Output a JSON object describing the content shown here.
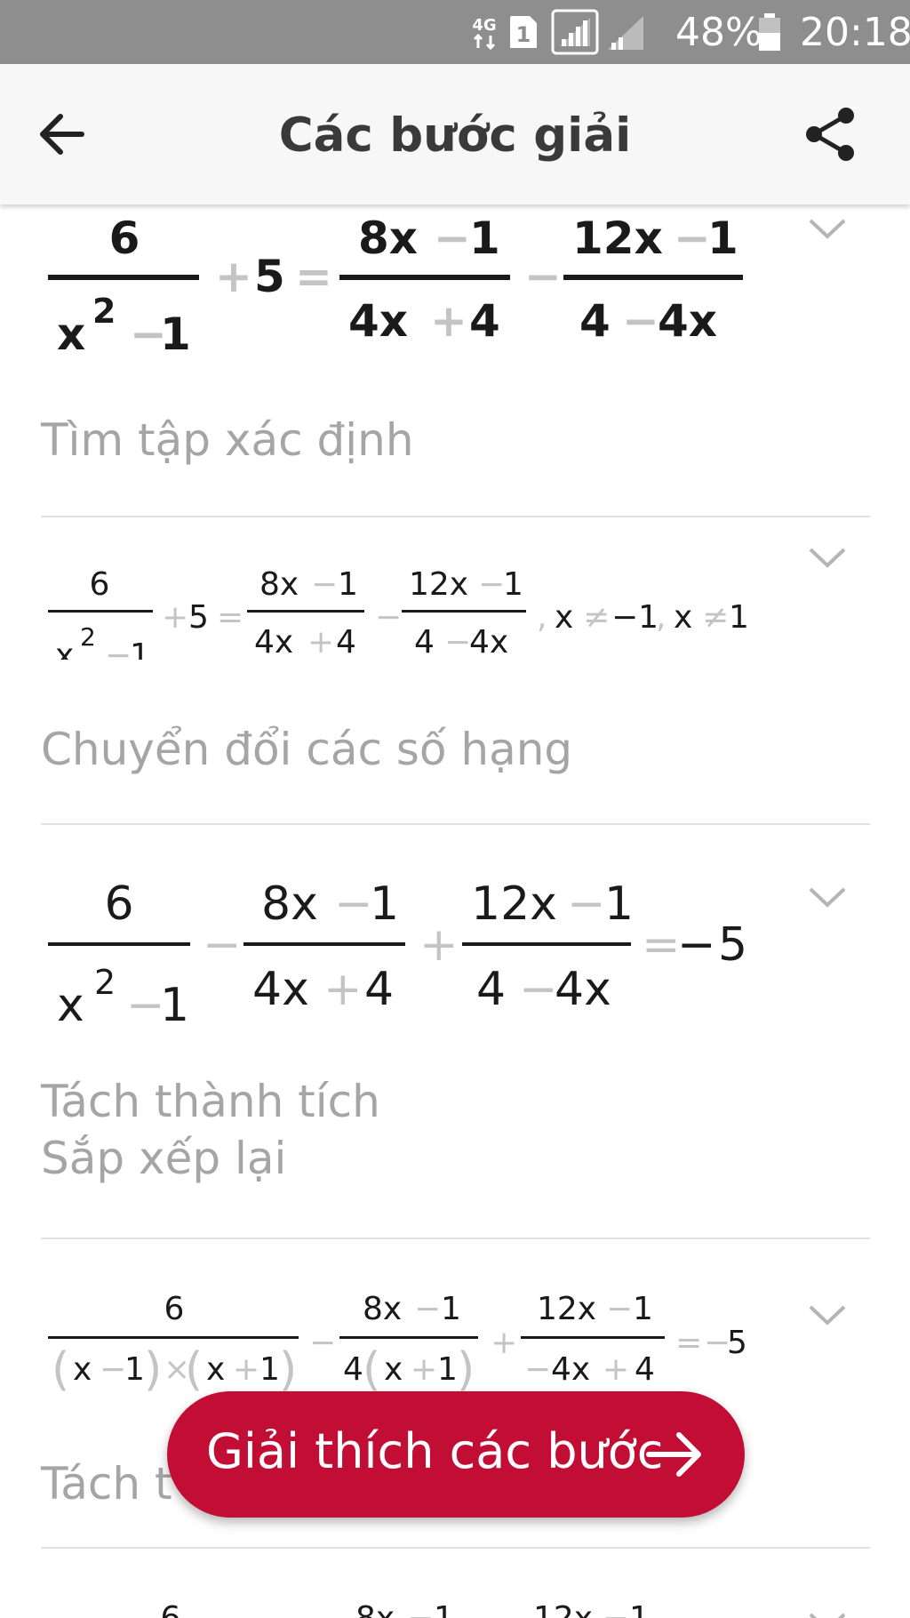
{
  "status_bar": {
    "network": "4G",
    "sim": "1",
    "battery": "48%",
    "time": "20:18"
  },
  "app_bar": {
    "title": "Các bước giải",
    "back_icon": "arrow-left-icon",
    "share_icon": "share-icon"
  },
  "steps": [
    {
      "equation": "6/(x^2 − 1) + 5 = (8x − 1)/(4x + 4) − (12x − 1)/(4 − 4x)",
      "label": "Tìm tập xác định"
    },
    {
      "equation": "6/(x^2 − 1) + 5 = (8x − 1)/(4x + 4) − (12x − 1)/(4 − 4x), x ≠ −1, x ≠ 1",
      "label": "Chuyển đổi các số hạng"
    },
    {
      "equation": "6/(x^2 − 1) − (8x − 1)/(4x + 4) + (12x − 1)/(4 − 4x) = −5",
      "label": "Tách thành tích",
      "label2": "Sắp xếp lại"
    },
    {
      "equation": "6/((x − 1)×(x + 1)) − (8x − 1)/(4(x + 1)) + (12x − 1)/(−4x + 4) = −5",
      "label": "Tách t"
    },
    {
      "equation": "6 … 8x − 1 … 12x − 1"
    }
  ],
  "fab": {
    "label": "Giải thích các bước",
    "icon": "arrow-right-icon"
  },
  "colors": {
    "accent": "#c20e35",
    "status_bar": "#8e8e8e",
    "label_gray": "#a5a5a5"
  }
}
